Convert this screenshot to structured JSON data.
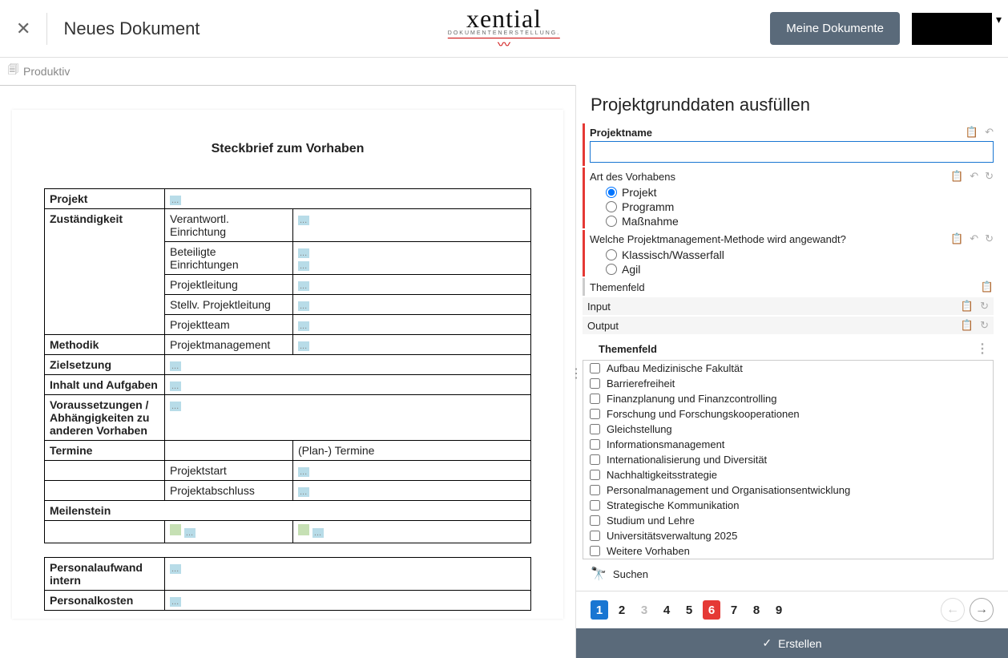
{
  "header": {
    "doc_title": "Neues Dokument",
    "logo_main": "xential",
    "logo_sub": "DOKUMENTENERSTELLUNG.",
    "mydocs": "Meine Dokumente"
  },
  "subheader": {
    "env": "Produktiv"
  },
  "preview": {
    "heading": "Steckbrief zum Vorhaben",
    "rows": {
      "projekt": "Projekt",
      "zustaendigkeit": "Zuständigkeit",
      "verantwortl": "Verantwortl. Einrichtung",
      "beteiligte": "Beteiligte Einrichtungen",
      "projektleitung": "Projektleitung",
      "stellv": "Stellv. Projektleitung",
      "projektteam": "Projektteam",
      "methodik": "Methodik",
      "methodik_val": "Projektmanagement",
      "zielsetzung": "Zielsetzung",
      "inhalt": "Inhalt und Aufgaben",
      "voraussetzungen": "Voraussetzungen / Abhängigkeiten zu anderen Vorhaben",
      "termine": "Termine",
      "plantermine": "(Plan-) Termine",
      "projektstart": "Projektstart",
      "projektabschluss": "Projektabschluss",
      "meilenstein": "Meilenstein",
      "personalaufwand": "Personalaufwand intern",
      "personalkosten": "Personalkosten"
    },
    "ph": "..."
  },
  "form": {
    "title": "Projektgrunddaten ausfüllen",
    "q_projektname": "Projektname",
    "q_art": "Art des Vorhabens",
    "opt_projekt": "Projekt",
    "opt_programm": "Programm",
    "opt_massnahme": "Maßnahme",
    "q_methode": "Welche Projektmanagement-Methode wird angewandt?",
    "opt_klassisch": "Klassisch/Wasserfall",
    "opt_agil": "Agil",
    "q_themenfeld": "Themenfeld",
    "q_input": "Input",
    "q_output": "Output",
    "themenfeld_header": "Themenfeld",
    "theme_items": [
      "Aufbau Medizinische Fakultät",
      "Barrierefreiheit",
      "Finanzplanung und Finanzcontrolling",
      "Forschung und Forschungskooperationen",
      "Gleichstellung",
      "Informationsmanagement",
      "Internationalisierung und Diversität",
      "Nachhaltigkeitsstrategie",
      "Personalmanagement und Organisationsentwicklung",
      "Strategische Kommunikation",
      "Studium und Lehre",
      "Universitätsverwaltung 2025",
      "Weitere Vorhaben"
    ],
    "search": "Suchen"
  },
  "footer": {
    "pages": [
      "1",
      "2",
      "3",
      "4",
      "5",
      "6",
      "7",
      "8",
      "9"
    ],
    "create": "Erstellen"
  }
}
